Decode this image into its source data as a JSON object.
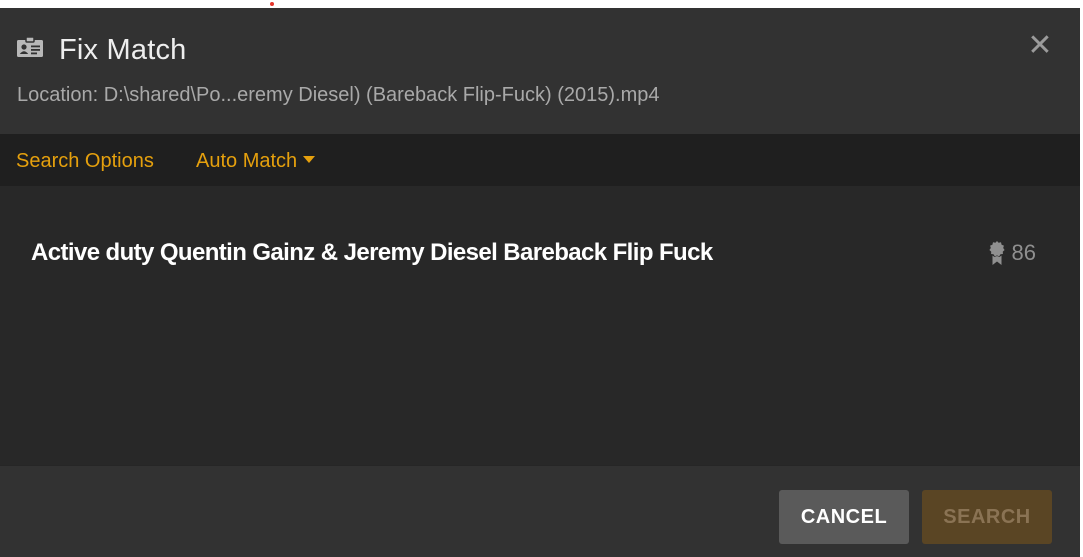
{
  "dialog": {
    "title": "Fix Match",
    "location_label": "Location: D:\\shared\\Po...eremy Diesel) (Bareback Flip-Fuck) (2015).mp4",
    "close_icon": "close-icon",
    "title_icon": "id-card-icon"
  },
  "options": {
    "search_options_label": "Search Options",
    "auto_match_label": "Auto Match"
  },
  "results": [
    {
      "title": "Active duty Quentin Gainz & Jeremy Diesel Bareback Flip Fuck",
      "score": "86",
      "score_icon": "award-icon"
    }
  ],
  "footer": {
    "cancel_label": "CANCEL",
    "search_label": "SEARCH"
  },
  "colors": {
    "accent": "#e5a00d",
    "background": "#2c2c2c",
    "header": "#323232",
    "options_bar": "#1f1f1f",
    "search_button_disabled": "#5a4524"
  }
}
